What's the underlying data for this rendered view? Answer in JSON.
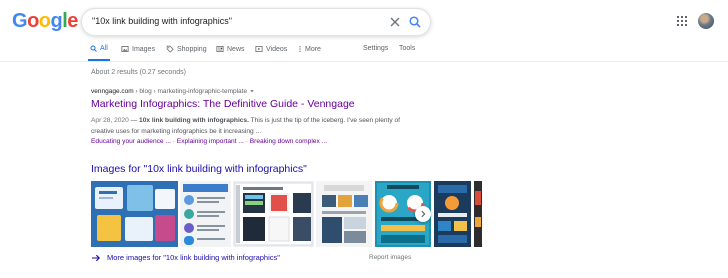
{
  "logo": {
    "letters": [
      "G",
      "o",
      "o",
      "g",
      "l",
      "e"
    ],
    "colors": [
      "#4285f4",
      "#ea4335",
      "#fbbc05",
      "#4285f4",
      "#34a853",
      "#ea4335"
    ]
  },
  "search": {
    "query": "\"10x link building with infographics\""
  },
  "tabs": [
    {
      "label": "All",
      "icon": "search-icon",
      "active": true
    },
    {
      "label": "Images",
      "icon": "image-icon"
    },
    {
      "label": "Shopping",
      "icon": "tag-icon"
    },
    {
      "label": "News",
      "icon": "news-icon"
    },
    {
      "label": "Videos",
      "icon": "video-icon"
    },
    {
      "label": "More",
      "icon": "more-vert-icon"
    },
    {
      "label": "Settings"
    },
    {
      "label": "Tools"
    }
  ],
  "stats": "About 2 results (0.27 seconds)",
  "result": {
    "site": "venngage.com",
    "crumbs": " › blog › marketing-infographic-template ",
    "title": "Marketing Infographics: The Definitive Guide - Venngage",
    "date": "Apr 28, 2020",
    "dash": " — ",
    "snippet_bold": "10x link building with infographics.",
    "snippet_rest": " This is just the tip of the iceberg. I've seen plenty of creative uses for marketing infographics be it increasing ...",
    "sitelinks": [
      "Educating your audience ...",
      "Explaining important ...",
      "Breaking down complex ..."
    ],
    "sitelink_sep": " · "
  },
  "images": {
    "heading": "Images for \"10x link building with infographics\"",
    "more": "More images for \"10x link building with infographics\"",
    "report": "Report images"
  }
}
